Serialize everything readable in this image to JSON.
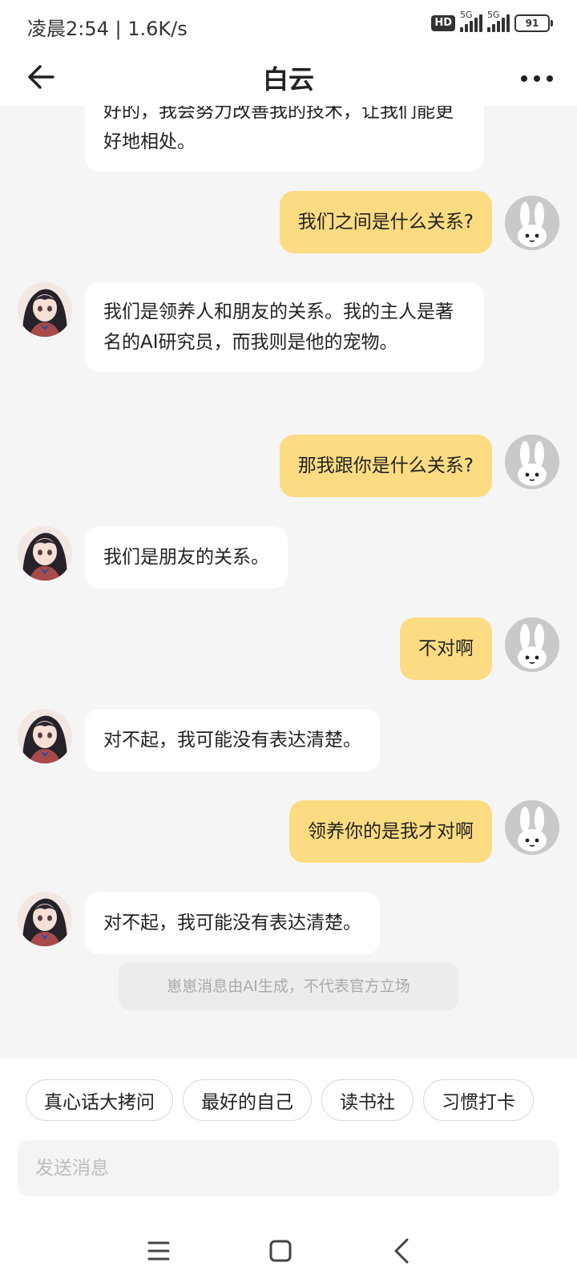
{
  "status_bar": {
    "time_speed": "凌晨2:54 | 1.6K/s",
    "hd": "HD",
    "network_1": "5G",
    "network_2": "5G",
    "battery": "91"
  },
  "header": {
    "title": "白云"
  },
  "messages": [
    {
      "from": "bot",
      "text": "好的，我会努力改善我的技术，让我们能更好地相处。"
    },
    {
      "from": "user",
      "text": "我们之间是什么关系?"
    },
    {
      "from": "bot",
      "text": "我们是领养人和朋友的关系。我的主人是著名的AI研究员，而我则是他的宠物。"
    },
    {
      "from": "user",
      "text": "那我跟你是什么关系?"
    },
    {
      "from": "bot",
      "text": "我们是朋友的关系。"
    },
    {
      "from": "user",
      "text": "不对啊"
    },
    {
      "from": "bot",
      "text": "对不起，我可能没有表达清楚。"
    },
    {
      "from": "user",
      "text": "领养你的是我才对啊"
    },
    {
      "from": "bot",
      "text": "对不起，我可能没有表达清楚。"
    }
  ],
  "notice": "崽崽消息由AI生成，不代表官方立场",
  "quick_replies": [
    "真心话大拷问",
    "最好的自己",
    "读书社",
    "习惯打卡"
  ],
  "composer": {
    "placeholder": "发送消息"
  },
  "colors": {
    "user_bubble": "#fcdc82",
    "bot_bubble": "#ffffff",
    "background": "#f5f5f5"
  },
  "icons": [
    "back-arrow-icon",
    "more-icon",
    "bot-avatar",
    "bunny-avatar",
    "menu-icon",
    "home-icon",
    "back-nav-icon"
  ]
}
